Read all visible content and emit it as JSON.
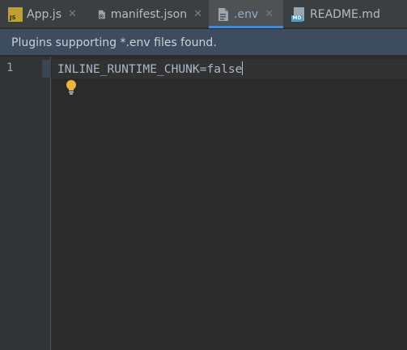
{
  "tabs": [
    {
      "label": "App.js",
      "icon": "js-file-icon",
      "active": false
    },
    {
      "label": "manifest.json",
      "icon": "json-file-icon",
      "active": false
    },
    {
      "label": ".env",
      "icon": "env-file-icon",
      "active": true
    },
    {
      "label": "README.md",
      "icon": "markdown-file-icon",
      "active": false
    }
  ],
  "notification": {
    "text": "Plugins supporting *.env files found."
  },
  "editor": {
    "lines": [
      {
        "number": "1",
        "text": "INLINE_RUNTIME_CHUNK=false"
      }
    ]
  },
  "icons": {
    "js_badge": "JS",
    "md_badge": "MD"
  },
  "colors": {
    "accent": "#4a88c7",
    "notification_bg": "#3d4c5e",
    "bulb": "#f0b43c"
  }
}
